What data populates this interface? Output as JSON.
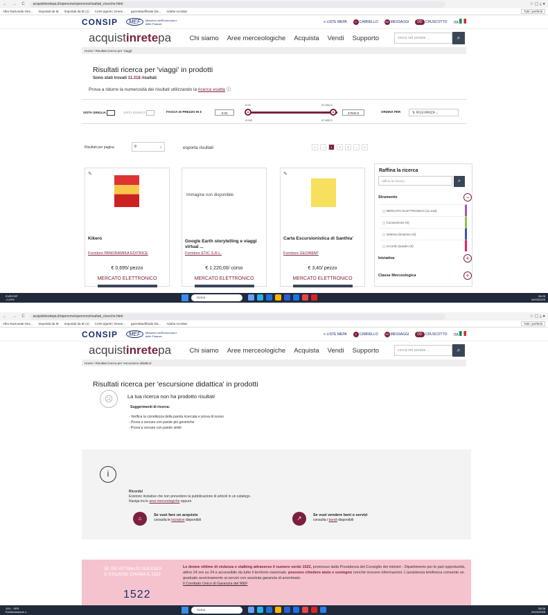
{
  "browser": {
    "url1": "acquistinretepa.it/opencms/opencms/risultati_ricerche.html",
    "url2": "acquistinretepa.it/opencms/opencms/risultati_ricerche.html",
    "nav": "← → C",
    "bookmarks": [
      "Albo Nazionale Ges...",
      "Importati da IE",
      "Importati da IE (1)",
      "CAM vigenti | Green...",
      "gazzettaufficiale.it/a...",
      "Adobe Acrobat"
    ],
    "bookmarks_right": "Tutti i preferiti"
  },
  "top": {
    "consip": "CONSIP",
    "mef": "MEF",
    "mef_sub": "Ministero dell'Economia e delle Finanze",
    "links": {
      "liste": "LISTE MEPA",
      "carrello": "CARRELLO",
      "messaggi": "MESSAGGI",
      "cruscotto": "CRUSCOTTO",
      "lang": "ITA"
    },
    "badge_carrello": "0",
    "badge_messaggi": "99",
    "dd": "DD"
  },
  "header": {
    "logo_a": "acquist",
    "logo_b": "inrete",
    "logo_c": "pa",
    "menu": [
      "Chi siamo",
      "Aree merceologiche",
      "Acquista",
      "Vendi",
      "Supporto"
    ],
    "search_placeholder": "cerca nel portale ..."
  },
  "s1": {
    "breadcrumb": "Home / Risultati ricerca per 'viaggi'",
    "title": "Risultati ricerca per 'viaggi' in prodotti",
    "found_prefix": "Sono stati trovati ",
    "found_count": "11.318",
    "found_suffix": " risultati",
    "hint": "Prova a ridurre la numerosità dei risultati utilizzando la ",
    "hint_link": "ricerca esatta",
    "filters": {
      "griglia": "VISTA GRIGLIA",
      "elenco": "VISTA ELENCO",
      "fascia": "FASCIA DI PREZZO IN €",
      "min": "0.04",
      "max": "47632.5",
      "min_top": "0.04",
      "max_top": "47.632,5",
      "min_bot": "0.043",
      "max_bot": "47.632,5",
      "ordina": "ORDINA PER",
      "ordina_val": "RILEVANZA"
    },
    "rpp_label": "Risultati per pagina",
    "rpp_val": "9",
    "export": "esporta risultati",
    "pages": [
      "«",
      "‹",
      "1",
      "2",
      "3",
      "›",
      "»"
    ],
    "cards": [
      {
        "name": "Kikero",
        "supplier": "Fornitore PANORAMIKA EDITRICE",
        "price": "€ 0,695/ pezzo",
        "market": "MERCATO ELETTRONICO"
      },
      {
        "name": "Google Earth storytelling e viaggi virtual ...",
        "supplier": "Fornitore ETIC S.R.L.",
        "price": "€ 1.220,00/ corso",
        "market": "MERCATO ELETTRONICO",
        "noimg": "Immagine non disponibile"
      },
      {
        "name": "Carta Escursionistica di Santhia'",
        "supplier": "Fornitore GEO4MAP",
        "price": "€ 3,40/ pezzo",
        "market": "MERCATO ELETTRONICO"
      }
    ],
    "raffina": {
      "title": "Raffina la ricerca",
      "placeholder": "raffina la ricerca...",
      "strumento": "Strumento",
      "items": [
        "MERCATO ELETTRONICO (11.318)",
        "Convenzione (0)",
        "Sistema Dinamico (0)",
        "Accordo Quadro (0)"
      ],
      "iniziativa": "Iniziativa",
      "classe": "Classe Merceologica"
    },
    "taskbar": {
      "weather": "EUR/CHF",
      "weather2": "-0,22%",
      "search": "Cerca",
      "time": "08:25",
      "date": "04/03/2025"
    }
  },
  "s2": {
    "breadcrumb": "Home / Risultati ricerca per 'escursione didattica'",
    "title": "Risultati ricerca per 'escursione didattica' in prodotti",
    "noresult": "La tua ricerca non ha prodotto risultati",
    "sugg": "Suggerimenti di ricerca:",
    "sugg_items": [
      "- Verifica la correttezza della parola ricercata e prova di nuovo",
      "- Prova a cercare con parole più generiche",
      "- Prova a cercare con parole simili"
    ],
    "ricorda": "Ricorda!",
    "ricorda_t": "Esistono iniziative che non prevedono la pubblicazione di articoli in un catalogo.",
    "ricorda_t2": "Naviga tra le ",
    "ricorda_link": "aree merceologiche",
    "ricorda_t3": " oppure",
    "acq_title": "Se vuoi fare un acquisto",
    "acq_t": "consulta le ",
    "acq_link": "iniziative",
    "acq_t2": " disponibili",
    "ven_title": "Se vuoi vendere beni o servizi",
    "ven_t": "consulta i ",
    "ven_link": "bandi",
    "ven_t2": " disponibili",
    "violence_1": "SE SEI VITTIMA DI VIOLENZA",
    "violence_2": "O STALKING CHIAMA IL 1522",
    "violence_num": "1522",
    "pink_text_a": "Le donne vittime di violenza e stalking attraverso il numero verde 1522,",
    "pink_text_b": " promosso dalla Presidenza del Consiglio dei ministri - Dipartimento per le pari opportunità, attivo 24 ore su 24 e accessibile da tutto il territorio nazionale, ",
    "pink_text_c": "possono chiedere aiuto e sostegno",
    "pink_text_d": " nonché ricevere informazioni. L'assistenza telefonica consente un graduale avvicinamento ai servizi con assoluta garanzia di anonimato.",
    "pink_text_e": "Il Comitato Unico di Garanzia del MEF",
    "taskbar": {
      "weather": "JUV - VER",
      "weather2": "Evidenziazione v...",
      "search": "Cerca",
      "time": "08:26",
      "date": "04/03/2025"
    }
  }
}
